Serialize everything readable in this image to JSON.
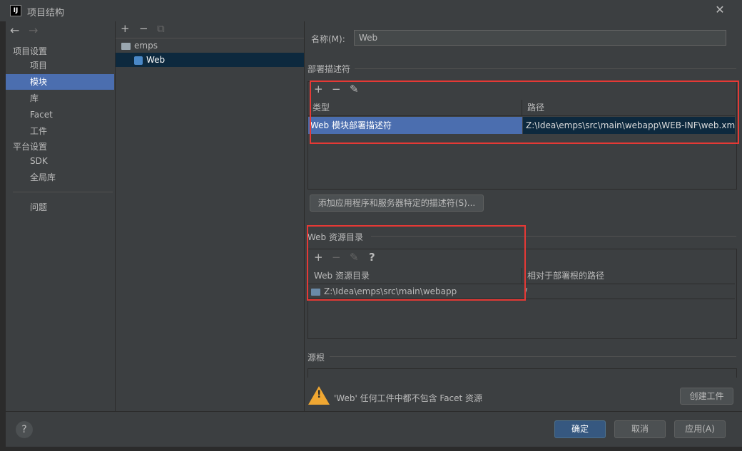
{
  "window": {
    "title": "项目结构",
    "app_icon": "IJ",
    "close": "✕"
  },
  "nav": {
    "back": "←",
    "forward": "→"
  },
  "sidebar": {
    "section1": "项目设置",
    "items1": [
      "项目",
      "模块",
      "库",
      "Facet",
      "工件"
    ],
    "section2": "平台设置",
    "items2": [
      "SDK",
      "全局库"
    ],
    "problems": "问题"
  },
  "module_tree": {
    "toolbar": {
      "add": "+",
      "remove": "−",
      "copy": "⧉"
    },
    "items": [
      "emps",
      "Web"
    ]
  },
  "details": {
    "name_label": "名称(M):",
    "name_value": "Web",
    "deploy_section": "部署描述符",
    "deploy_toolbar": {
      "add": "+",
      "remove": "−",
      "edit": "✎"
    },
    "deploy_headers": [
      "类型",
      "路径"
    ],
    "deploy_rows": [
      {
        "type": "Web 模块部署描述符",
        "path": "Z:\\Idea\\emps\\src\\main\\webapp\\WEB-INF\\web.xm"
      }
    ],
    "add_descriptor_button": "添加应用程序和服务器特定的描述符(S)...",
    "web_res_section": "Web 资源目录",
    "web_res_toolbar": {
      "add": "+",
      "remove": "−",
      "edit": "✎",
      "help": "?"
    },
    "web_res_headers": [
      "Web 资源目录",
      "相对于部署根的路径"
    ],
    "web_res_rows": [
      {
        "dir": "Z:\\Idea\\emps\\src\\main\\webapp",
        "rel": "/"
      }
    ],
    "source_roots_section": "源根",
    "warning_text": "'Web' 任何工件中都不包含 Facet 资源",
    "create_artifact_button": "创建工件"
  },
  "footer": {
    "help": "?",
    "ok": "确定",
    "cancel": "取消",
    "apply": "应用(A)"
  },
  "colors": {
    "accent": "#4b6eaf",
    "highlight_box": "#e53935",
    "warning": "#f0a732"
  }
}
